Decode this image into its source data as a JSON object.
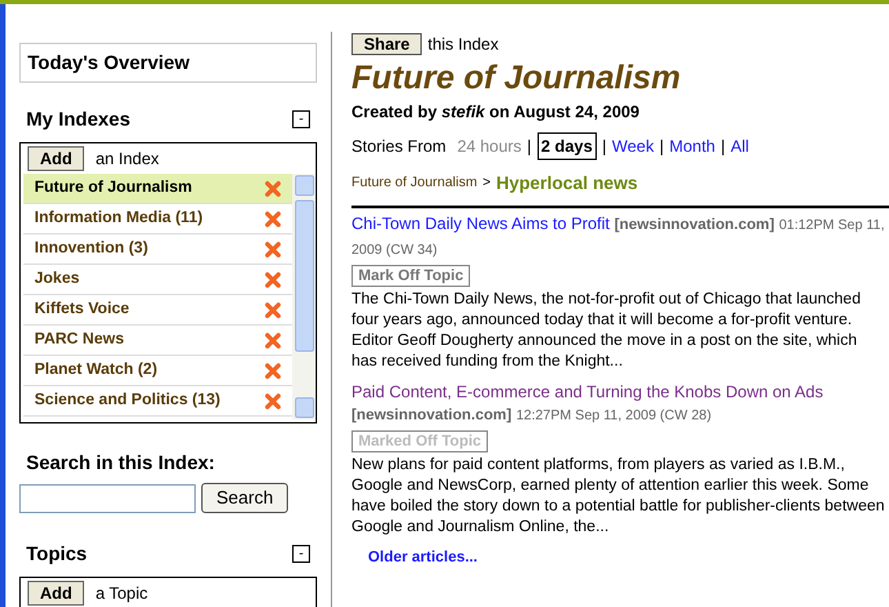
{
  "sidebar": {
    "overview": {
      "title": "Today's Overview"
    },
    "indexes": {
      "title": "My Indexes",
      "collapse": "-",
      "add_button": "Add",
      "add_label": "an Index",
      "items": [
        {
          "label": "Future of Journalism",
          "selected": true
        },
        {
          "label": "Information Media (11)",
          "selected": false
        },
        {
          "label": "Innovention (3)",
          "selected": false
        },
        {
          "label": "Jokes",
          "selected": false
        },
        {
          "label": "Kiffets Voice",
          "selected": false
        },
        {
          "label": "PARC News",
          "selected": false
        },
        {
          "label": "Planet Watch (2)",
          "selected": false
        },
        {
          "label": "Science and Politics (13)",
          "selected": false
        }
      ]
    },
    "search": {
      "title": "Search in this Index:",
      "button": "Search"
    },
    "topics": {
      "title": "Topics",
      "collapse": "-",
      "add_button": "Add",
      "add_label": "a Topic"
    }
  },
  "main": {
    "share_button": "Share",
    "share_label": "this Index",
    "title": "Future of Journalism",
    "created_prefix": "Created by",
    "author": "stefik",
    "created_suffix": "on August 24, 2009",
    "stories_from": {
      "label": "Stories From",
      "separator": "|",
      "options": [
        {
          "label": "24 hours",
          "selected": false,
          "disabled": true
        },
        {
          "label": "2 days",
          "selected": true,
          "disabled": false
        },
        {
          "label": "Week",
          "selected": false,
          "disabled": false
        },
        {
          "label": "Month",
          "selected": false,
          "disabled": false
        },
        {
          "label": "All",
          "selected": false,
          "disabled": false
        }
      ]
    },
    "breadcrumb": {
      "parent": "Future of Journalism",
      "separator": ">",
      "current": "Hyperlocal news"
    },
    "articles": [
      {
        "title": "Chi-Town Daily News Aims to Profit",
        "visited": false,
        "source": "[newsinnovation.com]",
        "date": "01:12PM Sep 11, 2009 (CW 34)",
        "marked": false,
        "mark_button": "Mark Off Topic",
        "summary": "The Chi-Town Daily News, the not-for-profit out of Chicago that launched four years ago, announced today that it will become a for-profit venture. Editor Geoff Dougherty announced the move in a post on the site, which has received funding from the Knight..."
      },
      {
        "title": "Paid Content, E-commerce and Turning the Knobs Down on Ads",
        "visited": true,
        "source": "[newsinnovation.com]",
        "date": "12:27PM Sep 11, 2009 (CW 28)",
        "marked": true,
        "mark_button": "Marked Off Topic",
        "summary": "New plans for paid content platforms, from players as varied as I.B.M., Google and NewsCorp, earned plenty of attention earlier this week. Some have boiled the story down to a potential battle for publisher-clients between Google and Journalism Online, the..."
      }
    ],
    "older_link": "Older articles..."
  }
}
